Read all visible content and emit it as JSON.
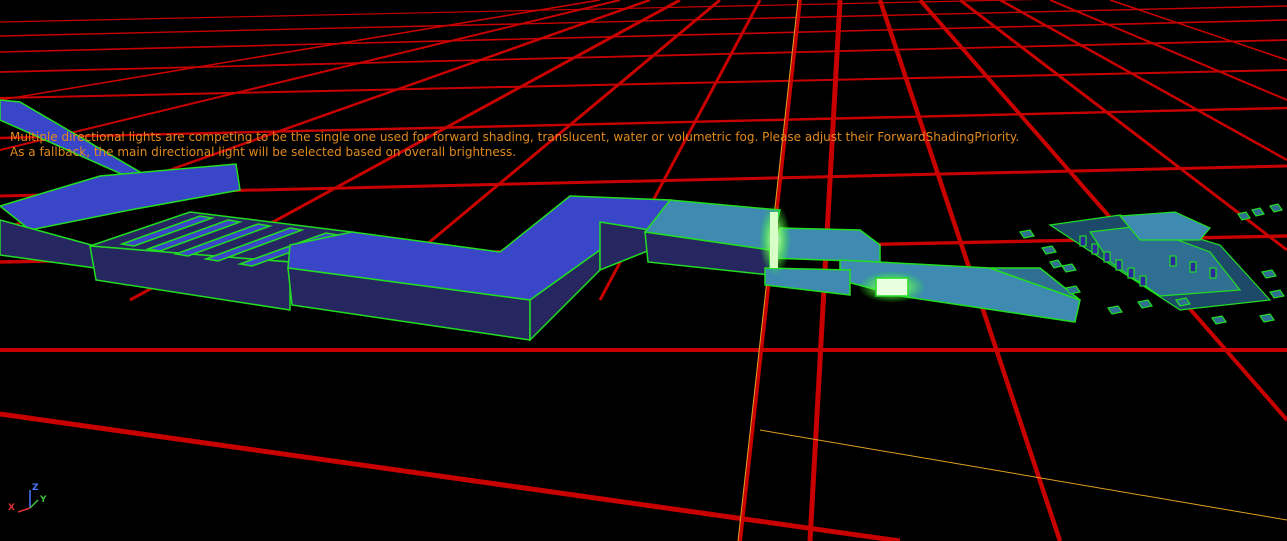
{
  "viewport": {
    "background_color": "#000000",
    "grid_color": "#c80000",
    "selection_outline_color": "#22dd22",
    "actor_bounds_color": "#e0a020",
    "geometry_colors": {
      "wall_top": "#3a46c8",
      "wall_side": "#262660",
      "platform_top": "#3e8ab0",
      "light_glow": "#b6ff9a"
    }
  },
  "warning": {
    "color": "#e08a1e",
    "lines": [
      "Multiple directional lights are competing to be the single one used for forward shading, translucent, water or volumetric fog. Please adjust their ForwardShadingPriority.",
      "As a fallback, the main directional light will be selected based on overall brightness."
    ]
  },
  "axis_gizmo": {
    "z_label": "Z",
    "y_label": "Y",
    "x_label": "X",
    "z_color": "#4a78ff",
    "y_color": "#3fbf3f",
    "x_color": "#e03030"
  }
}
